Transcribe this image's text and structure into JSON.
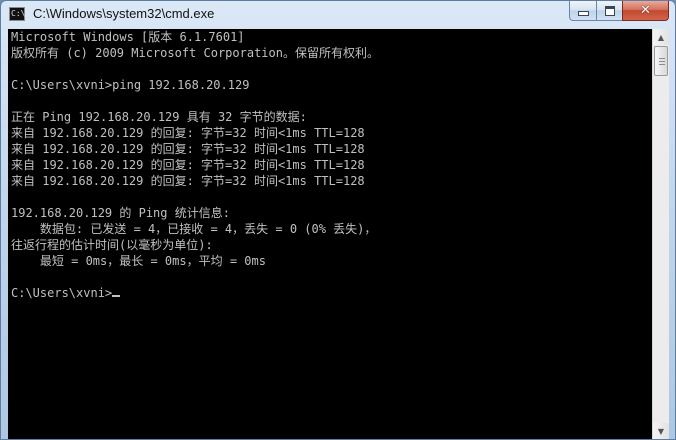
{
  "window": {
    "title": "C:\\Windows\\system32\\cmd.exe",
    "icon": "cmd-icon",
    "icon_text": "C:\\",
    "controls": {
      "minimize": "minimize-icon",
      "maximize": "maximize-icon",
      "close": "close-icon"
    },
    "close_glyph": "✕"
  },
  "console": {
    "foreground": "#c0c0c0",
    "background": "#000000",
    "lines": [
      "Microsoft Windows [版本 6.1.7601]",
      "版权所有 (c) 2009 Microsoft Corporation。保留所有权利。",
      "",
      "C:\\Users\\xvni>ping 192.168.20.129",
      "",
      "正在 Ping 192.168.20.129 具有 32 字节的数据:",
      "来自 192.168.20.129 的回复: 字节=32 时间<1ms TTL=128",
      "来自 192.168.20.129 的回复: 字节=32 时间<1ms TTL=128",
      "来自 192.168.20.129 的回复: 字节=32 时间<1ms TTL=128",
      "来自 192.168.20.129 的回复: 字节=32 时间<1ms TTL=128",
      "",
      "192.168.20.129 的 Ping 统计信息:",
      "    数据包: 已发送 = 4，已接收 = 4，丢失 = 0 (0% 丢失)，",
      "往返行程的估计时间(以毫秒为单位):",
      "    最短 = 0ms，最长 = 0ms，平均 = 0ms",
      "",
      "C:\\Users\\xvni>"
    ]
  },
  "scrollbar": {
    "up_glyph": "▲",
    "down_glyph": "▼"
  }
}
